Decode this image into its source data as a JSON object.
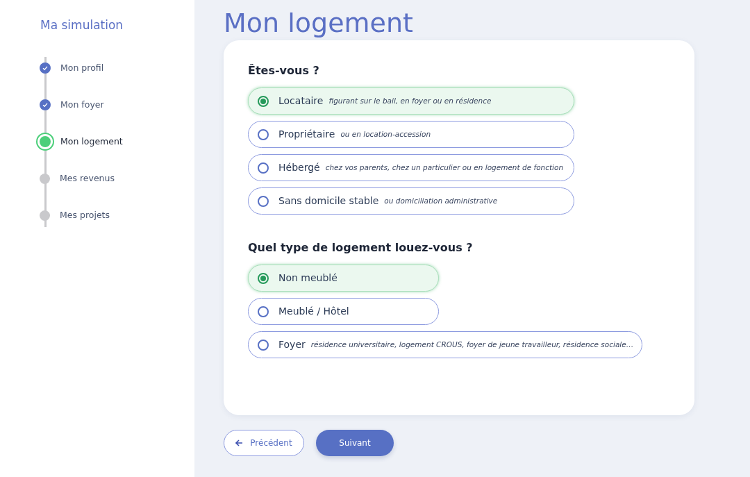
{
  "sidebar": {
    "title": "Ma simulation",
    "steps": [
      {
        "label": "Mon profil",
        "completed": true,
        "current": false
      },
      {
        "label": "Mon foyer",
        "completed": true,
        "current": false
      },
      {
        "label": "Mon logement",
        "completed": false,
        "current": true
      },
      {
        "label": "Mes revenus",
        "completed": false,
        "current": false
      },
      {
        "label": "Mes projets",
        "completed": false,
        "current": false
      }
    ]
  },
  "page_title": "Mon logement",
  "questions": [
    {
      "title": "Êtes-vous ?",
      "options": [
        {
          "label": "Locataire",
          "hint": "figurant sur le bail, en foyer ou en résidence",
          "selected": true
        },
        {
          "label": "Propriétaire",
          "hint": "ou en location-accession",
          "selected": false
        },
        {
          "label": "Hébergé",
          "hint": "chez vos parents, chez un particulier ou en logement de fonction",
          "selected": false
        },
        {
          "label": "Sans domicile stable",
          "hint": "ou domiciliation administrative",
          "selected": false
        }
      ]
    },
    {
      "title": "Quel type de logement louez-vous ?",
      "options": [
        {
          "label": "Non meublé",
          "selected": true
        },
        {
          "label": "Meublé / Hôtel",
          "selected": false
        },
        {
          "label": "Foyer",
          "hint": "résidence universitaire, logement CROUS, foyer de jeune travailleur, résidence sociale…",
          "selected": false
        }
      ]
    }
  ],
  "buttons": {
    "previous": "Précédent",
    "next": "Suivant"
  }
}
